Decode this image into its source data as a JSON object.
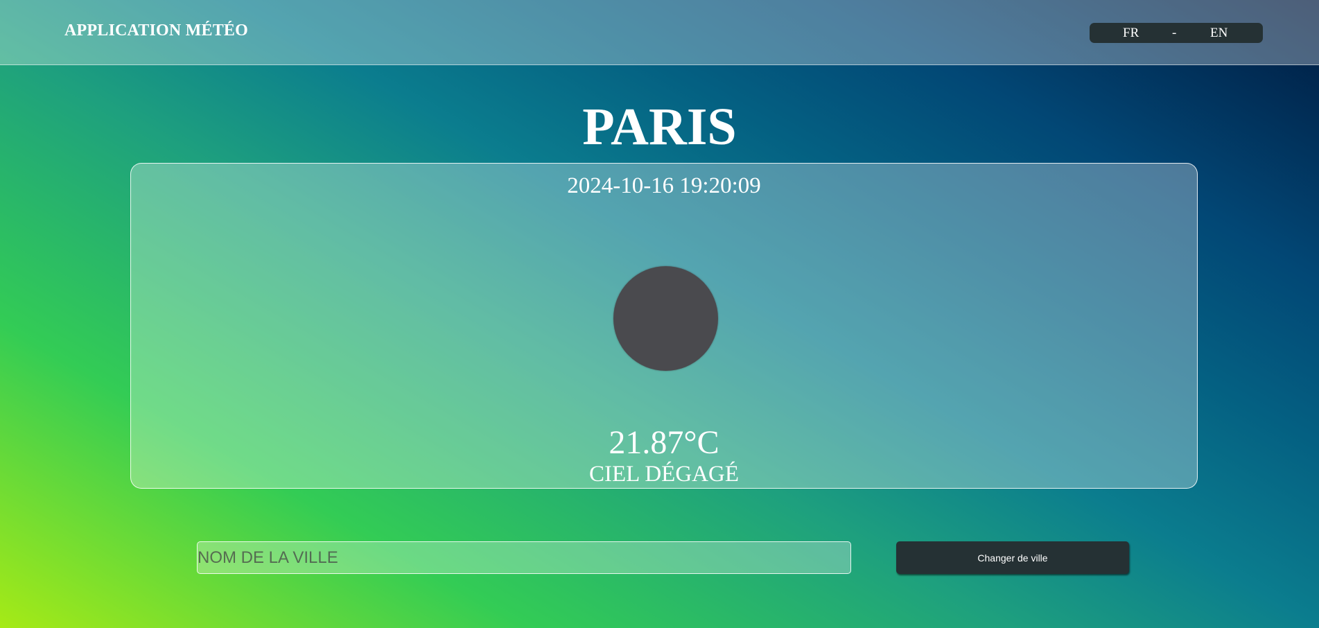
{
  "header": {
    "app_title": "APPLICATION MÉTÉO",
    "languages": {
      "fr": "FR",
      "separator": "-",
      "en": "EN"
    }
  },
  "weather": {
    "city": "PARIS",
    "datetime": "2024-10-16 19:20:09",
    "icon": "weather-icon",
    "temperature": "21.87°C",
    "condition": "CIEL DÉGAGÉ"
  },
  "search": {
    "placeholder": "NOM DE LA VILLE",
    "value": "",
    "button_label": "Changer de ville"
  },
  "colors": {
    "button_bg": "#253134",
    "icon_fill": "#4a4a4e",
    "text": "#ffffff"
  }
}
